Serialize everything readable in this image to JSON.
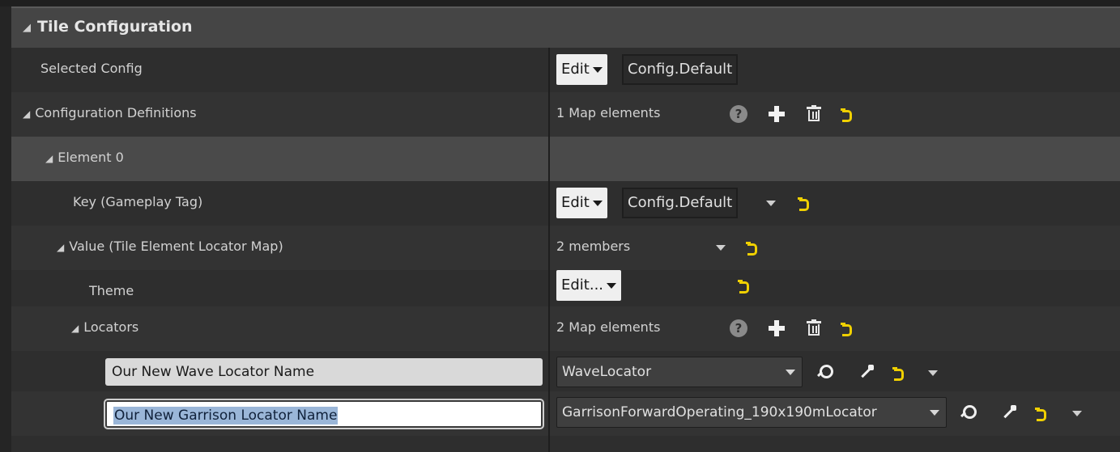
{
  "category": {
    "title": "Tile Configuration"
  },
  "rows": {
    "selected_config": {
      "label": "Selected Config",
      "edit_label": "Edit",
      "tag": "Config.Default"
    },
    "config_defs": {
      "label": "Configuration Definitions",
      "count": "1 Map elements"
    },
    "element0": {
      "label": "Element 0"
    },
    "key": {
      "label": "Key (Gameplay Tag)",
      "edit_label": "Edit",
      "tag": "Config.Default"
    },
    "value": {
      "label": "Value (Tile Element Locator Map)",
      "count": "2 members"
    },
    "theme": {
      "label": "Theme",
      "edit_label": "Edit..."
    },
    "locators": {
      "label": "Locators",
      "count": "2 Map elements"
    },
    "locator1": {
      "name": "Our New Wave Locator Name",
      "value": "WaveLocator"
    },
    "locator2": {
      "name": "Our New Garrison Locator Name",
      "value": "GarrisonForwardOperating_190x190mLocator"
    }
  },
  "icons": {
    "collapse": "triangle-collapse-icon",
    "help": "question-icon",
    "add": "plus-icon",
    "delete": "trash-icon",
    "reset": "reset-to-default-icon",
    "options": "chevron-down-icon",
    "browse": "search-icon",
    "pick": "picker-icon"
  },
  "colors": {
    "reset_accent": "#f0d000",
    "background": "#2e2e2e",
    "header": "#454545",
    "selection": "#9ab6d8"
  }
}
